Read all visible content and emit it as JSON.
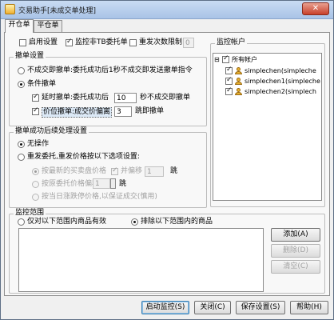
{
  "window": {
    "title": "交易助手[未成交单处理]",
    "close_glyph": "✕"
  },
  "tabs": [
    {
      "label": "开仓单",
      "active": true
    },
    {
      "label": "平仓单",
      "active": false
    }
  ],
  "top_options": {
    "enable": {
      "label": "启用设置",
      "checked": false
    },
    "monitor_non_tb": {
      "label": "监控非TB委托单",
      "checked": true
    },
    "repeat_limit": {
      "label": "重发次数限制",
      "checked": false,
      "value": "0"
    }
  },
  "cancel_settings": {
    "title": "撤单设置",
    "no_cancel": {
      "label": "不成交即撤单:委托成功后1秒不成交即发送撤单指令",
      "selected": false
    },
    "conditional": {
      "label": "条件撤单",
      "selected": true
    },
    "timed": {
      "label": "延时撤单:委托成功后",
      "checked": true,
      "value": "10",
      "suffix": "秒不成交即撤单"
    },
    "price_offset": {
      "label": "价位撤单:成交价偏离",
      "checked": true,
      "value": "3",
      "suffix": "跳即撤单"
    }
  },
  "after_cancel": {
    "title": "撤单成功后续处理设置",
    "no_action": {
      "label": "无操作",
      "selected": true
    },
    "resend": {
      "label": "重发委托,重发价格按以下选项设置:",
      "selected": false
    },
    "latest_price": {
      "label": "按最新的买卖盘价格",
      "selected": true
    },
    "with_offset": {
      "label": "并偏移",
      "checked": true,
      "value": "1",
      "suffix": "跳"
    },
    "orig_price": {
      "label": "按原委托价格偏移",
      "selected": false,
      "value": "1",
      "suffix": "跳"
    },
    "limit_price": {
      "label": "按当日涨跌停价格,以保证成交(慎用)",
      "selected": false
    }
  },
  "monitor_accounts": {
    "title": "监控帐户",
    "root": {
      "label": "所有帐户",
      "checked": true
    },
    "items": [
      {
        "label": "simplechen(simpleche",
        "checked": true
      },
      {
        "label": "simplechen1(simpleche",
        "checked": true
      },
      {
        "label": "simplechen2(simplech",
        "checked": true
      }
    ]
  },
  "monitor_scope": {
    "title": "监控范围",
    "only_in": {
      "label": "仅对以下范围内商品有效",
      "selected": false
    },
    "exclude": {
      "label": "排除以下范围内的商品",
      "selected": true
    },
    "buttons": {
      "add": "添加(A)",
      "delete": "删除(D)",
      "clear": "清空(C)"
    }
  },
  "footer": {
    "start": "启动监控(S)",
    "close": "关闭(C)",
    "save": "保存设置(S)",
    "help": "帮助(H)"
  }
}
